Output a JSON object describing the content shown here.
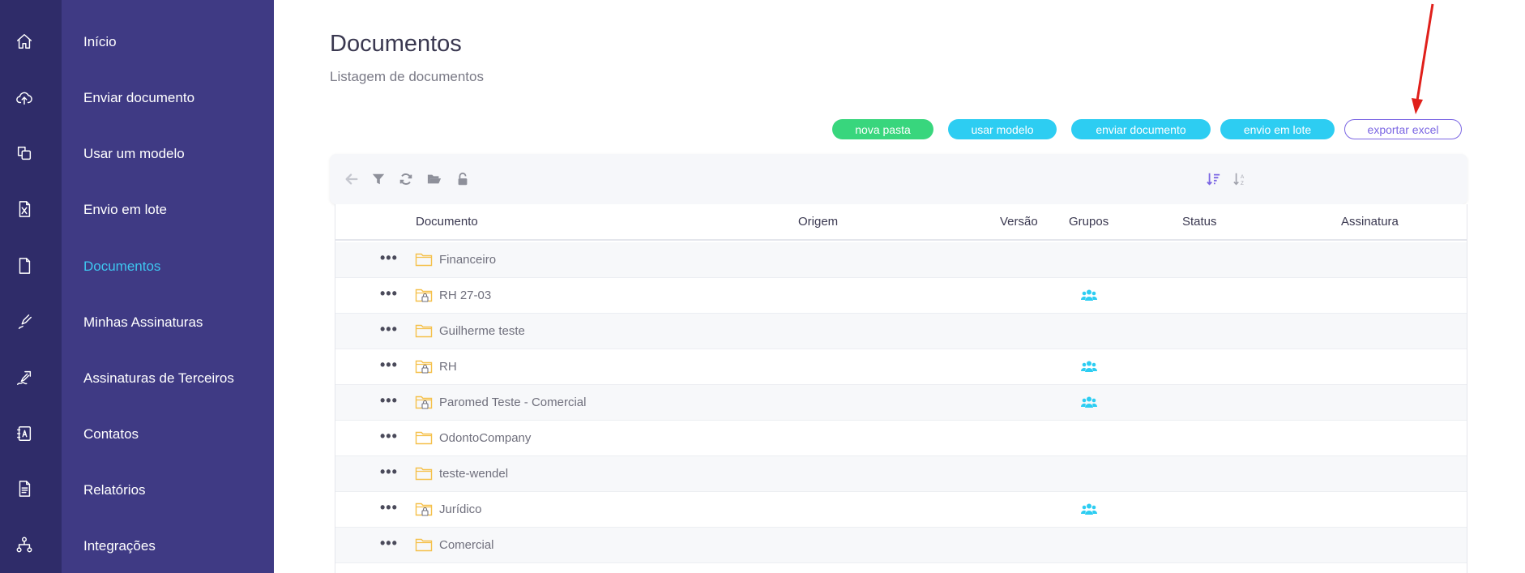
{
  "colors": {
    "rail_bg": "#2f2c69",
    "sidebar_bg": "#3f3a84",
    "active": "#3ec6f0",
    "green": "#38d67d",
    "cyan": "#2dcdf2",
    "purple": "#7b66e3",
    "folder": "#f5c04a",
    "annotation_arrow": "#e0201b"
  },
  "rail_icons": [
    "home-icon",
    "cloud-upload-icon",
    "copy-template-icon",
    "excel-file-icon",
    "document-icon",
    "pen-icon",
    "signature-icon",
    "contacts-icon",
    "report-icon",
    "network-icon"
  ],
  "sidebar": {
    "items": [
      {
        "label": "Início"
      },
      {
        "label": "Enviar documento"
      },
      {
        "label": "Usar um modelo"
      },
      {
        "label": "Envio em lote"
      },
      {
        "label": "Documentos"
      },
      {
        "label": "Minhas Assinaturas"
      },
      {
        "label": "Assinaturas de Terceiros"
      },
      {
        "label": "Contatos"
      },
      {
        "label": "Relatórios"
      },
      {
        "label": "Integrações"
      }
    ],
    "active_item": "Documentos"
  },
  "header": {
    "title": "Documentos",
    "subtitle": "Listagem de documentos"
  },
  "actions": {
    "nova_pasta": "nova pasta",
    "usar_modelo": "usar modelo",
    "enviar_documento": "enviar documento",
    "envio_em_lote": "envio em lote",
    "exportar_excel": "exportar excel"
  },
  "toolbar_icons": [
    "back-arrow-icon",
    "filter-icon",
    "refresh-icon",
    "open-folder-icon",
    "unlock-icon",
    "sort-desc-icon",
    "sort-alpha-icon"
  ],
  "table": {
    "columns": [
      "Documento",
      "Origem",
      "Versão",
      "Grupos",
      "Status",
      "Assinatura"
    ],
    "rows": [
      {
        "name": "Financeiro",
        "locked": false,
        "groups": false
      },
      {
        "name": "RH 27-03",
        "locked": true,
        "groups": true
      },
      {
        "name": "Guilherme teste",
        "locked": false,
        "groups": false
      },
      {
        "name": "RH",
        "locked": true,
        "groups": true
      },
      {
        "name": "Paromed Teste - Comercial",
        "locked": true,
        "groups": true
      },
      {
        "name": "OdontoCompany",
        "locked": false,
        "groups": false
      },
      {
        "name": "teste-wendel",
        "locked": false,
        "groups": false
      },
      {
        "name": "Jurídico",
        "locked": true,
        "groups": true
      },
      {
        "name": "Comercial",
        "locked": false,
        "groups": false
      }
    ],
    "row_menu_glyph": "•••"
  }
}
